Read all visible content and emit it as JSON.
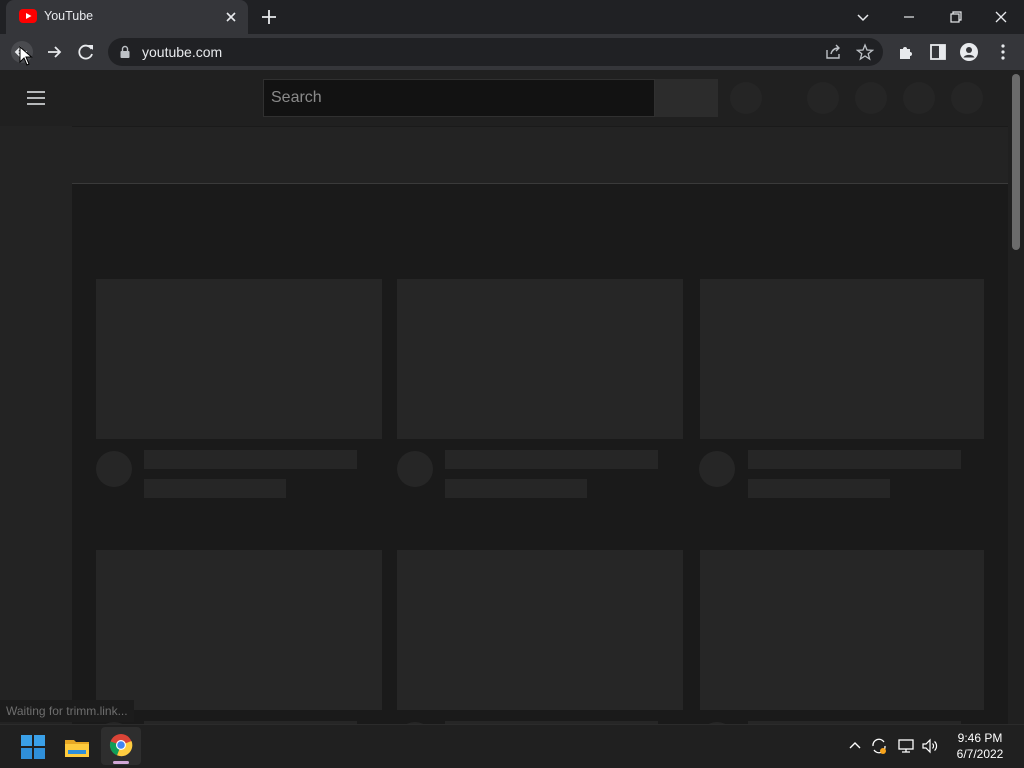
{
  "browser": {
    "tab": {
      "title": "YouTube",
      "favicon": "youtube-icon"
    },
    "address_bar": {
      "url": "youtube.com",
      "lock": "lock-icon"
    },
    "status_text": "Waiting for trimm.link..."
  },
  "youtube": {
    "search": {
      "placeholder": "Search",
      "value": ""
    }
  },
  "taskbar": {
    "apps": [
      "windows-start-icon",
      "file-explorer-icon",
      "chrome-icon"
    ],
    "clock": {
      "time": "9:46 PM",
      "date": "6/7/2022"
    }
  },
  "colors": {
    "youtube_red": "#ff0000",
    "chrome_tab_bg": "#35363a",
    "chrome_frame": "#202124",
    "page_bg": "#1a1a1a",
    "skeleton": "#262626"
  }
}
